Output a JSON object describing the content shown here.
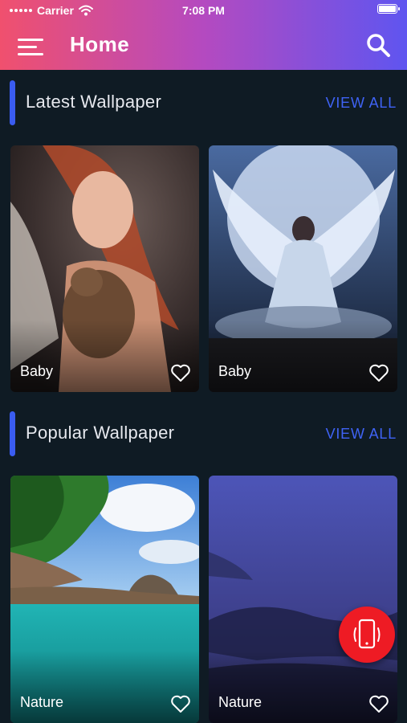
{
  "status_bar": {
    "carrier": "Carrier",
    "time": "7:08 PM"
  },
  "header": {
    "title": "Home"
  },
  "sections": [
    {
      "title": "Latest Wallpaper",
      "view_all": "VIEW ALL",
      "cards": [
        {
          "label": "Baby"
        },
        {
          "label": "Baby"
        }
      ]
    },
    {
      "title": "Popular Wallpaper",
      "view_all": "VIEW ALL",
      "cards": [
        {
          "label": "Nature"
        },
        {
          "label": "Nature"
        }
      ]
    }
  ],
  "colors": {
    "accent": "#3a5cf0",
    "fab": "#ee1b24",
    "background": "#0f1b24"
  },
  "icons": {
    "menu": "hamburger-menu-icon",
    "search": "search-icon",
    "favorite": "heart-outline-icon",
    "fab": "phone-rotate-icon"
  }
}
